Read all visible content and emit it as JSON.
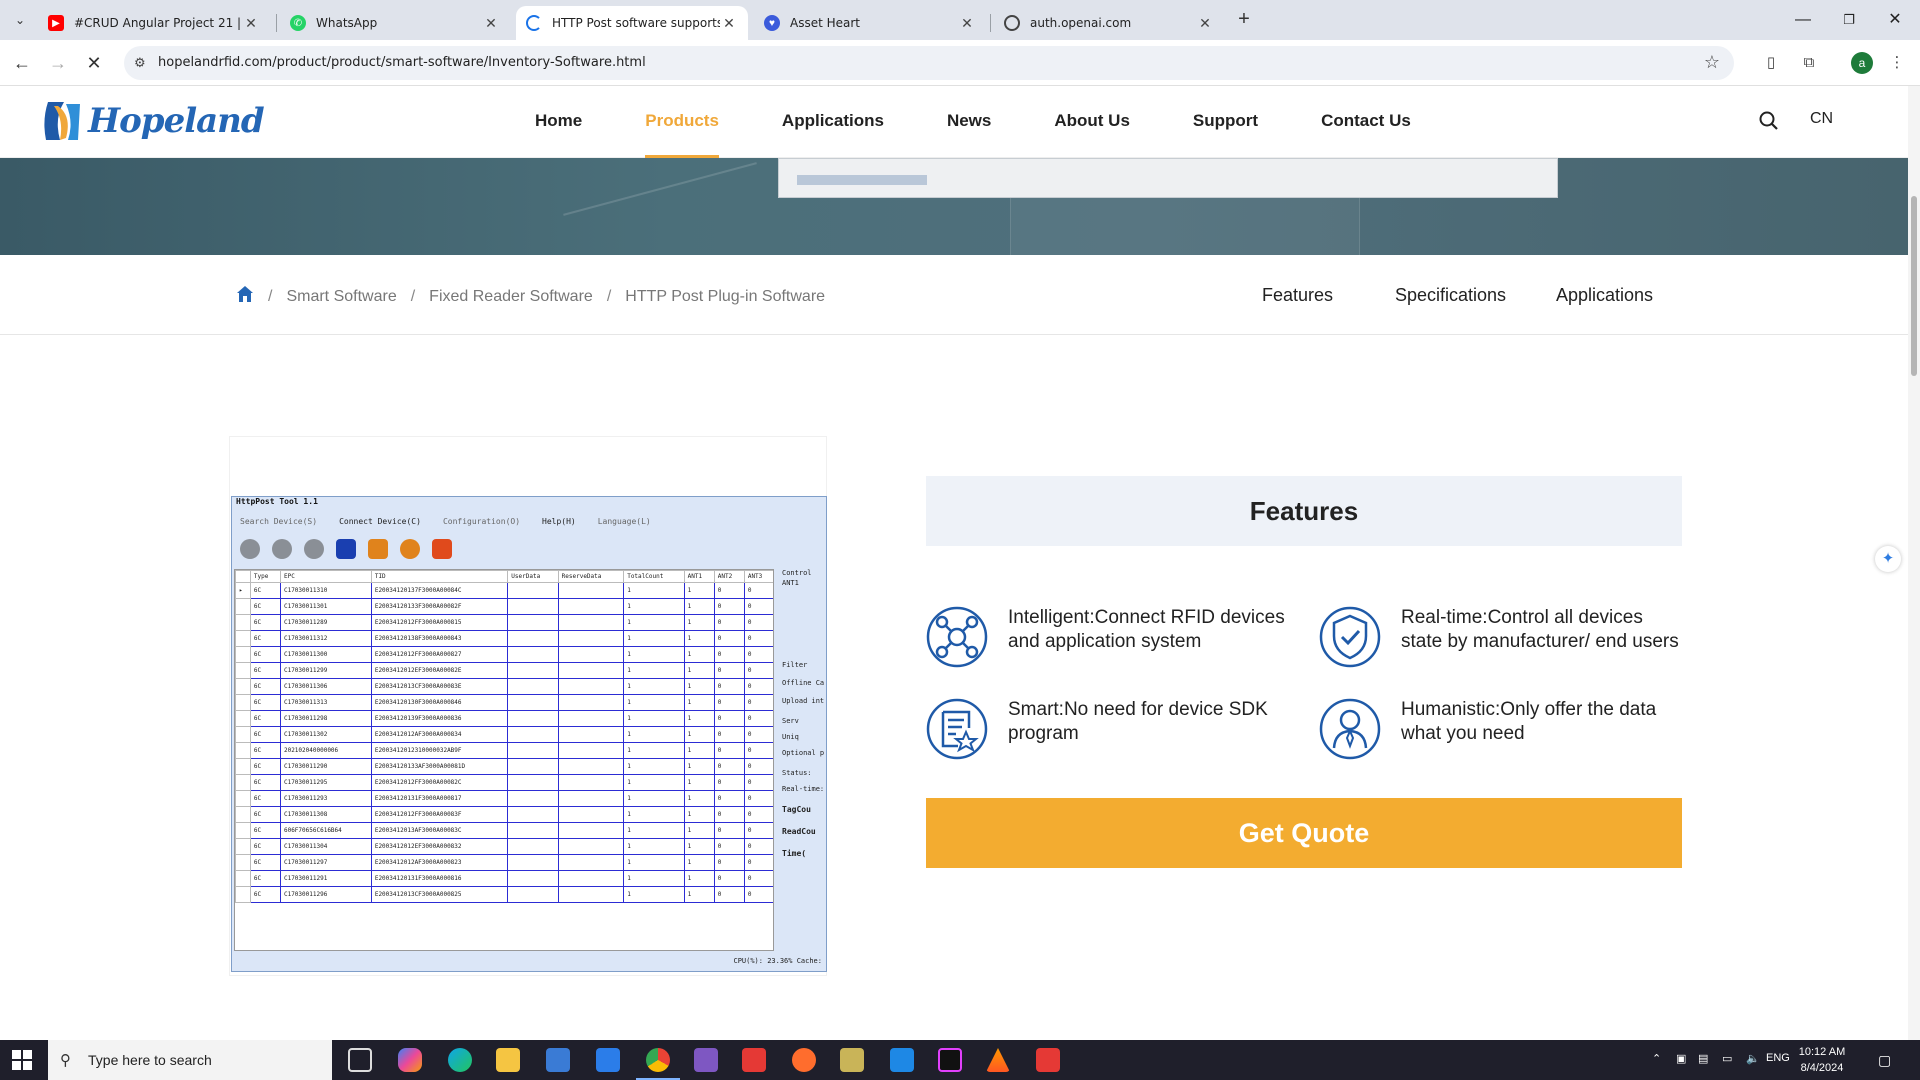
{
  "browser": {
    "tabs": [
      {
        "title": "#CRUD Angular Project 21 |ـل",
        "favicon": "youtube-icon",
        "color": "#ff0000"
      },
      {
        "title": "WhatsApp",
        "favicon": "whatsapp-icon",
        "color": "#25d366"
      },
      {
        "title": "HTTP Post software supports d",
        "favicon": "loading-icon",
        "color": "#1a73e8"
      },
      {
        "title": "Asset Heart",
        "favicon": "asset-heart-icon",
        "color": "#3b5bdb"
      },
      {
        "title": "auth.openai.com",
        "favicon": "openai-icon",
        "color": "#444444"
      }
    ],
    "active_tab": 2,
    "url": "hopelandrfid.com/product/product/smart-software/Inventory-Software.html",
    "profile_initial": "a"
  },
  "site": {
    "logo_text": "Hopeland",
    "nav": [
      "Home",
      "Products",
      "Applications",
      "News",
      "About Us",
      "Support",
      "Contact Us"
    ],
    "active_nav": "Products",
    "lang": "CN",
    "accent": "#f0a83a"
  },
  "breadcrumb": [
    "Smart Software",
    "Fixed Reader Software",
    "HTTP Post Plug-in Software"
  ],
  "subnav": [
    "Features",
    "Specifications",
    "Applications"
  ],
  "product_image": {
    "title": "HttpPost Tool 1.1",
    "menu": [
      "Search Device(S)",
      "Connect Device(C)",
      "Configuration(O)",
      "Help(H)",
      "Language(L)"
    ],
    "columns": [
      "Type",
      "EPC",
      "TID",
      "UserData",
      "ReserveData",
      "TotalCount",
      "ANT1",
      "ANT2",
      "ANT3"
    ],
    "rows": [
      [
        "6C",
        "C17030011310",
        "E20034120137F3000A00084C",
        "",
        "",
        "1",
        "1",
        "0",
        "0"
      ],
      [
        "6C",
        "C17030011301",
        "E20034120133F3000A00082F",
        "",
        "",
        "1",
        "1",
        "0",
        "0"
      ],
      [
        "6C",
        "C17030011289",
        "E2003412012FF3000A000815",
        "",
        "",
        "1",
        "1",
        "0",
        "0"
      ],
      [
        "6C",
        "C17030011312",
        "E20034120138F3000A000843",
        "",
        "",
        "1",
        "1",
        "0",
        "0"
      ],
      [
        "6C",
        "C17030011300",
        "E2003412012FF3000A000827",
        "",
        "",
        "1",
        "1",
        "0",
        "0"
      ],
      [
        "6C",
        "C17030011299",
        "E2003412012EF3000A00082E",
        "",
        "",
        "1",
        "1",
        "0",
        "0"
      ],
      [
        "6C",
        "C17030011306",
        "E2003412013CF3000A00083E",
        "",
        "",
        "1",
        "1",
        "0",
        "0"
      ],
      [
        "6C",
        "C17030011313",
        "E20034120130F3000A000846",
        "",
        "",
        "1",
        "1",
        "0",
        "0"
      ],
      [
        "6C",
        "C17030011298",
        "E20034120139F3000A000836",
        "",
        "",
        "1",
        "1",
        "0",
        "0"
      ],
      [
        "6C",
        "C17030011302",
        "E2003412012AF3000A000834",
        "",
        "",
        "1",
        "1",
        "0",
        "0"
      ],
      [
        "6C",
        "202102040000006",
        "E2003412012310000032AB9F",
        "",
        "",
        "1",
        "1",
        "0",
        "0"
      ],
      [
        "6C",
        "C17030011290",
        "E20034120133AF3000A00081D",
        "",
        "",
        "1",
        "1",
        "0",
        "0"
      ],
      [
        "6C",
        "C17030011295",
        "E2003412012FF3000A00082C",
        "",
        "",
        "1",
        "1",
        "0",
        "0"
      ],
      [
        "6C",
        "C17030011293",
        "E20034120131F3000A000817",
        "",
        "",
        "1",
        "1",
        "0",
        "0"
      ],
      [
        "6C",
        "C17030011308",
        "E2003412012FF3000A00083F",
        "",
        "",
        "1",
        "1",
        "0",
        "0"
      ],
      [
        "6C",
        "606F70656C616B64",
        "E2003412013AF3000A00083C",
        "",
        "",
        "1",
        "1",
        "0",
        "0"
      ],
      [
        "6C",
        "C17030011304",
        "E2003412012EF3000A000832",
        "",
        "",
        "1",
        "1",
        "0",
        "0"
      ],
      [
        "6C",
        "C17030011297",
        "E2003412012AF3000A000823",
        "",
        "",
        "1",
        "1",
        "0",
        "0"
      ],
      [
        "6C",
        "C17030011291",
        "E20034120131F3000A000816",
        "",
        "",
        "1",
        "1",
        "0",
        "0"
      ],
      [
        "6C",
        "C17030011296",
        "E2003412013CF3000A000825",
        "",
        "",
        "1",
        "1",
        "0",
        "0"
      ]
    ],
    "side_labels": [
      "Control",
      "ANT1",
      "Filter",
      "Offline Ca",
      "Upload int",
      "Serv",
      "Uniq",
      "Optional p",
      "Status:",
      "Real-time:",
      "TagCou",
      "ReadCou",
      "Time("
    ],
    "status": "CPU(%): 23.36% Cache:"
  },
  "features": {
    "heading": "Features",
    "items": [
      {
        "icon": "network-icon",
        "text": "Intelligent:Connect RFID devices and application system"
      },
      {
        "icon": "shield-check-icon",
        "text": "Real-time:Control all devices state by manufacturer/ end users"
      },
      {
        "icon": "document-star-icon",
        "text": "Smart:No need for device SDK program"
      },
      {
        "icon": "person-icon",
        "text": "Humanistic:Only offer the data what you need"
      }
    ],
    "cta": "Get Quote",
    "cta_color": "#f3ac30"
  },
  "taskbar": {
    "search_placeholder": "Type here to search",
    "lang": "ENG",
    "time": "10:12 AM",
    "date": "8/4/2024"
  }
}
